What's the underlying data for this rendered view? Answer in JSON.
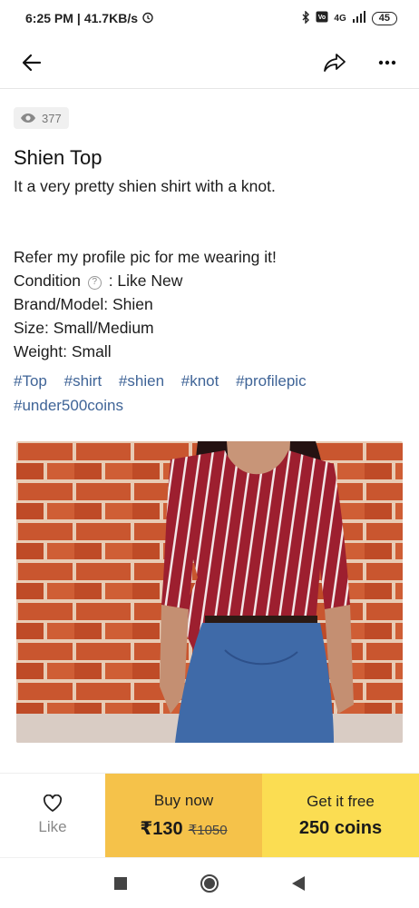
{
  "status_bar": {
    "time": "6:25 PM",
    "speed": "41.7KB/s",
    "network": "4G",
    "battery": "45"
  },
  "app_bar": {
    "back_icon": "arrow-left-icon",
    "share_icon": "share-icon",
    "more_icon": "more-dots-icon"
  },
  "listing": {
    "views": "377",
    "title": "Shien Top",
    "description_line1": "It a very pretty shien shirt with a knot.",
    "description_line2": "Refer my profile pic for me wearing it!",
    "condition_label": "Condition",
    "condition_value": ": Like New",
    "brand": "Brand/Model: Shien",
    "size": "Size: Small/Medium",
    "weight": "Weight: Small",
    "tags": [
      "#Top",
      "#shirt",
      "#shien",
      "#knot",
      "#profilepic",
      "#under500coins"
    ]
  },
  "actions": {
    "like_label": "Like",
    "buy_label": "Buy now",
    "buy_price": "₹130",
    "buy_old_price": "₹1050",
    "free_label": "Get it free",
    "free_coins": "250 coins",
    "buy_color": "#f5c24a",
    "free_color": "#fbdd52"
  },
  "colors": {
    "tag": "#3f6497",
    "brick": "#c8542f",
    "shirt": "#9d1f2f",
    "jeans": "#3f6aa8"
  }
}
